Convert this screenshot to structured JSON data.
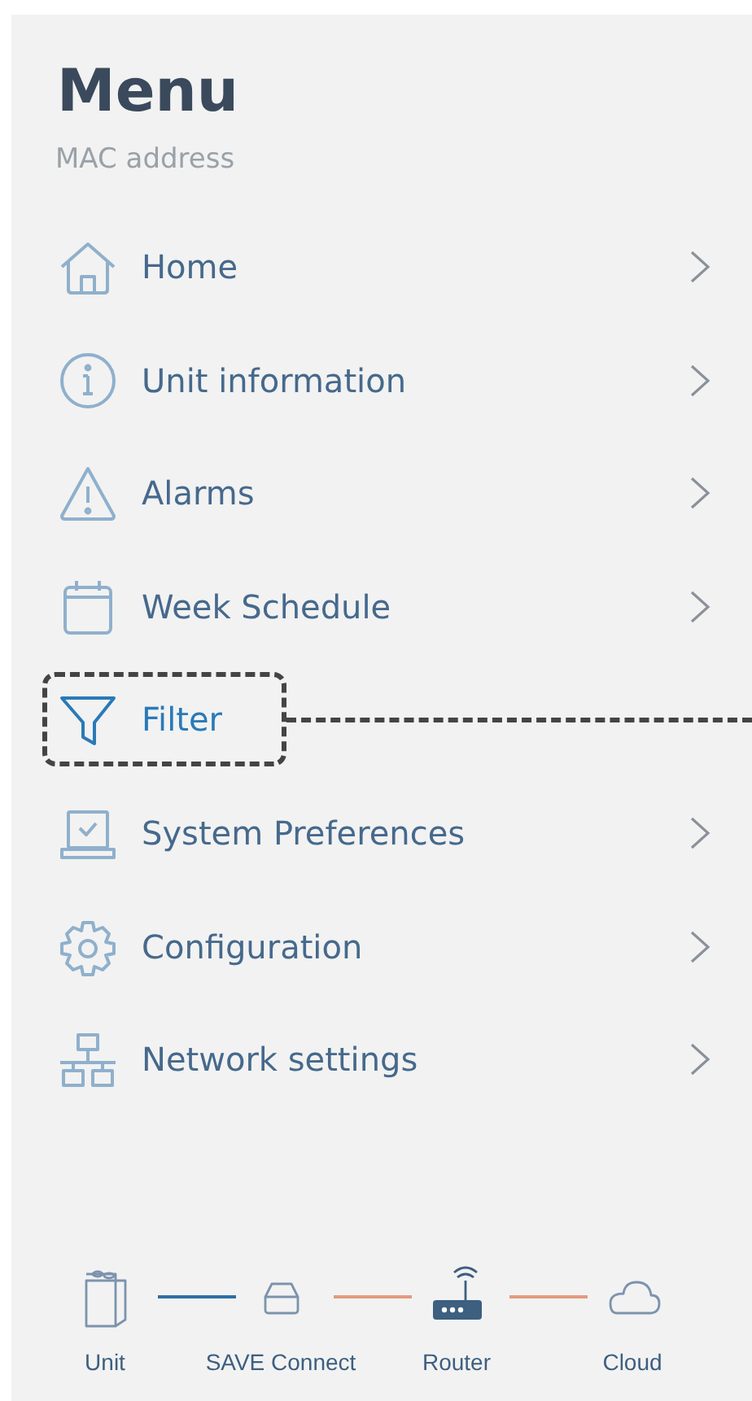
{
  "title": "Menu",
  "subtitle": "MAC address",
  "menu": [
    {
      "kind": "home",
      "label": "Home",
      "selected": false
    },
    {
      "kind": "info",
      "label": "Unit information",
      "selected": false
    },
    {
      "kind": "alarm",
      "label": "Alarms",
      "selected": false
    },
    {
      "kind": "calendar",
      "label": "Week Schedule",
      "selected": false
    },
    {
      "kind": "filter",
      "label": "Filter",
      "selected": true
    },
    {
      "kind": "laptop",
      "label": "System Preferences",
      "selected": false
    },
    {
      "kind": "gear",
      "label": "Configuration",
      "selected": false
    },
    {
      "kind": "network",
      "label": "Network settings",
      "selected": false
    }
  ],
  "devices": [
    {
      "kind": "unit",
      "label": "Unit"
    },
    {
      "kind": "gateway",
      "label": "SAVE Connect"
    },
    {
      "kind": "router",
      "label": "Router"
    },
    {
      "kind": "cloud",
      "label": "Cloud"
    }
  ],
  "links": [
    {
      "color": "#2f6fa3"
    },
    {
      "color": "#e39a7e"
    },
    {
      "color": "#e39a7e"
    }
  ]
}
